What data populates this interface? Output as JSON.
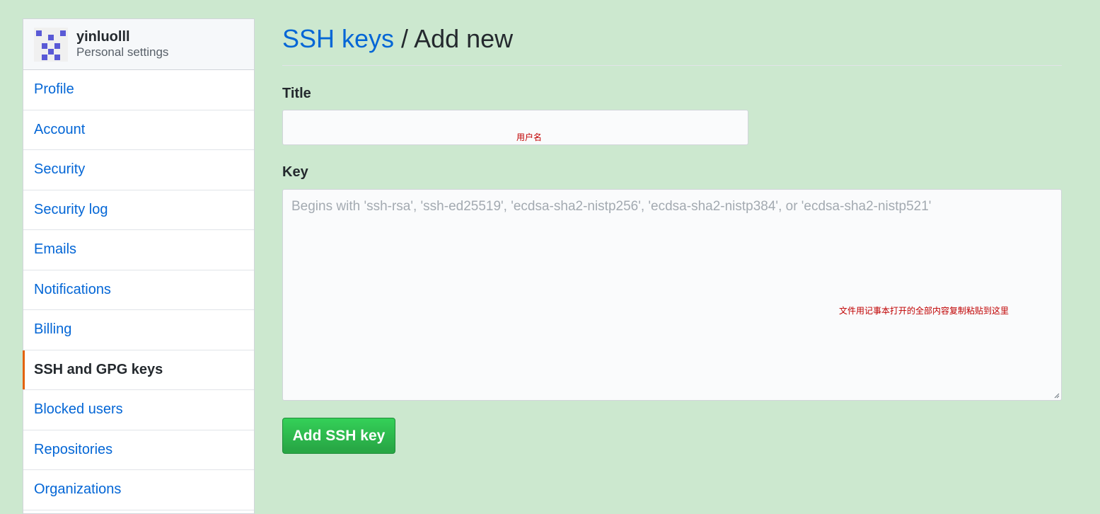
{
  "sidebar": {
    "username": "yinluolll",
    "subtitle": "Personal settings",
    "items": [
      {
        "label": "Profile"
      },
      {
        "label": "Account"
      },
      {
        "label": "Security"
      },
      {
        "label": "Security log"
      },
      {
        "label": "Emails"
      },
      {
        "label": "Notifications"
      },
      {
        "label": "Billing"
      },
      {
        "label": "SSH and GPG keys",
        "selected": true
      },
      {
        "label": "Blocked users"
      },
      {
        "label": "Repositories"
      },
      {
        "label": "Organizations"
      }
    ]
  },
  "main": {
    "breadcrumb_link": "SSH keys",
    "breadcrumb_sep": " / ",
    "page_title": "Add new",
    "title_label": "Title",
    "title_value": "",
    "title_annotation": "用户名",
    "key_label": "Key",
    "key_placeholder": "Begins with 'ssh-rsa', 'ssh-ed25519', 'ecdsa-sha2-nistp256', 'ecdsa-sha2-nistp384', or 'ecdsa-sha2-nistp521'",
    "key_annotation": "文件用记事本打开的全部内容复制粘贴到这里",
    "submit_label": "Add SSH key"
  },
  "colors": {
    "page_background": "#cce8cf",
    "link": "#0366d6",
    "selected_indicator": "#e36209",
    "button_green": "#28a745",
    "annotation_red": "#c00000"
  }
}
